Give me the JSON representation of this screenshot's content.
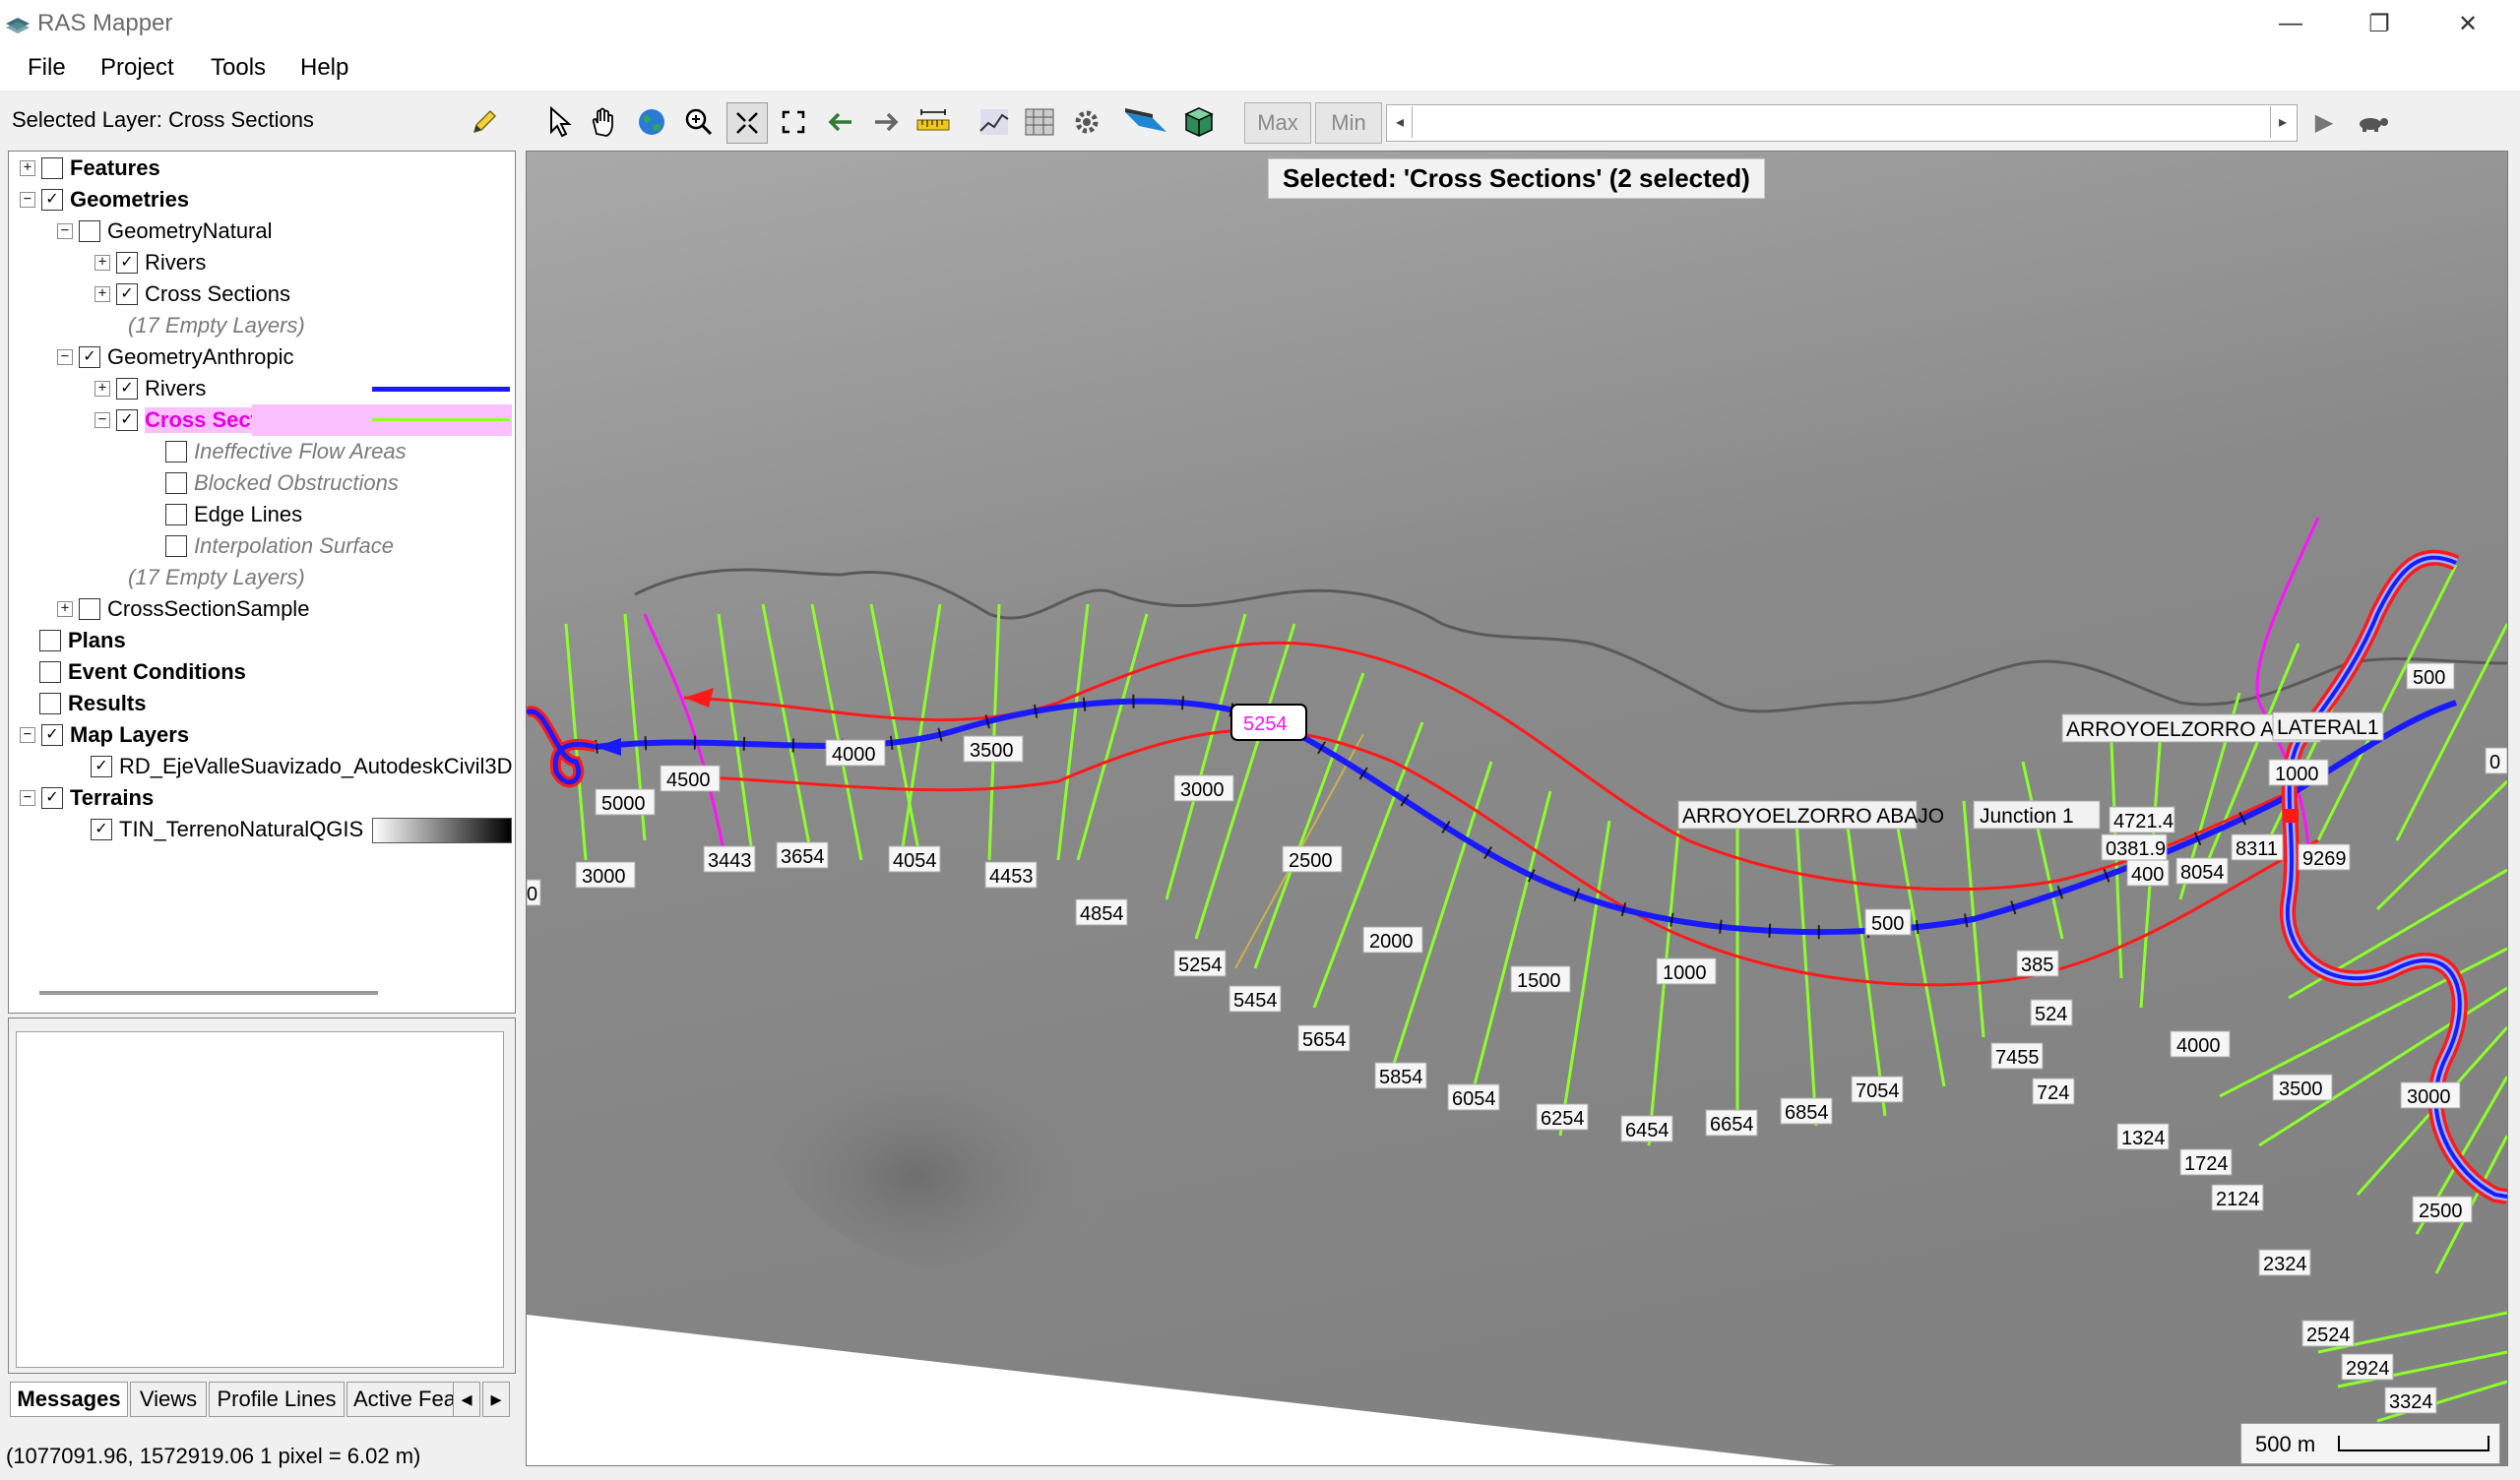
{
  "window": {
    "title": "RAS Mapper",
    "minimize_glyph": "—",
    "restore_glyph": "❐",
    "close_glyph": "✕"
  },
  "menu": [
    "File",
    "Project",
    "Tools",
    "Help"
  ],
  "selected_layer_label": "Selected Layer: Cross Sections",
  "tree": {
    "features": "Features",
    "geometries": "Geometries",
    "geometry_natural": "GeometryNatural",
    "gn_rivers": "Rivers",
    "gn_cross_sections": "Cross Sections",
    "gn_empty": "(17 Empty Layers)",
    "geometry_anthropic": "GeometryAnthropic",
    "ga_rivers": "Rivers",
    "ga_cross_sections": "Cross Sections",
    "ineffective": "Ineffective Flow Areas",
    "blocked": "Blocked Obstructions",
    "edge_lines": "Edge Lines",
    "interp_surface": "Interpolation Surface",
    "ga_empty": "(17 Empty Layers)",
    "cross_section_sample": "CrossSectionSample",
    "plans": "Plans",
    "event_conditions": "Event Conditions",
    "results": "Results",
    "map_layers": "Map Layers",
    "rd_layer": "RD_EjeValleSuavizado_AutodeskCivil3D",
    "terrains": "Terrains",
    "tin_layer": "TIN_TerrenoNaturalQGIS"
  },
  "bottom_tabs": [
    "Messages",
    "Views",
    "Profile Lines",
    "Active Fea"
  ],
  "status": "(1077091.96, 1572919.06  1 pixel = 6.02 m)",
  "toolbar": {
    "max_label": "Max",
    "min_label": "Min",
    "icons": [
      "select-arrow-icon",
      "pan-hand-icon",
      "globe-icon",
      "zoom-in-icon",
      "zoom-extent-icon",
      "full-extent-icon",
      "back-arrow-icon",
      "forward-arrow-icon",
      "measure-ruler-icon",
      "profile-icon",
      "grid-icon",
      "gear-tool-icon",
      "water-layer-icon",
      "3d-view-icon"
    ]
  },
  "map": {
    "selected_banner": "Selected: 'Cross Sections' (2 selected)",
    "scale_label": "500 m",
    "reach_labels": [
      "ARROYOELZORRO  ABAJO",
      "Junction 1",
      "ARROYOELZORRO  ARRIBA",
      "LATERAL1"
    ],
    "station_labels": [
      "4000",
      "3500",
      "3000",
      "2500",
      "2000",
      "1500",
      "1000",
      "500",
      "5000",
      "4500",
      "3000",
      "500",
      "1000",
      "4000",
      "3500",
      "3000",
      "2500",
      "0",
      "0"
    ],
    "xs_labels": [
      "3443",
      "3654",
      "4054",
      "4453",
      "4854",
      "5254",
      "5454",
      "5654",
      "5854",
      "6054",
      "6254",
      "6454",
      "6654",
      "6854",
      "7054",
      "7455",
      "724",
      "524",
      "385",
      "1324",
      "1724",
      "2124",
      "2324",
      "2524",
      "2924",
      "3324",
      "8311",
      "9269",
      "8054",
      "4721.4",
      "0381.9",
      "400"
    ],
    "selected_xs_label": "5254"
  },
  "colors": {
    "river_blue": "#1a1aff",
    "bank_red": "#ff1a1a",
    "xs_green": "#8cff2a",
    "selected_magenta": "#ff10ff",
    "highlight_bg": "#fbc0ff"
  }
}
